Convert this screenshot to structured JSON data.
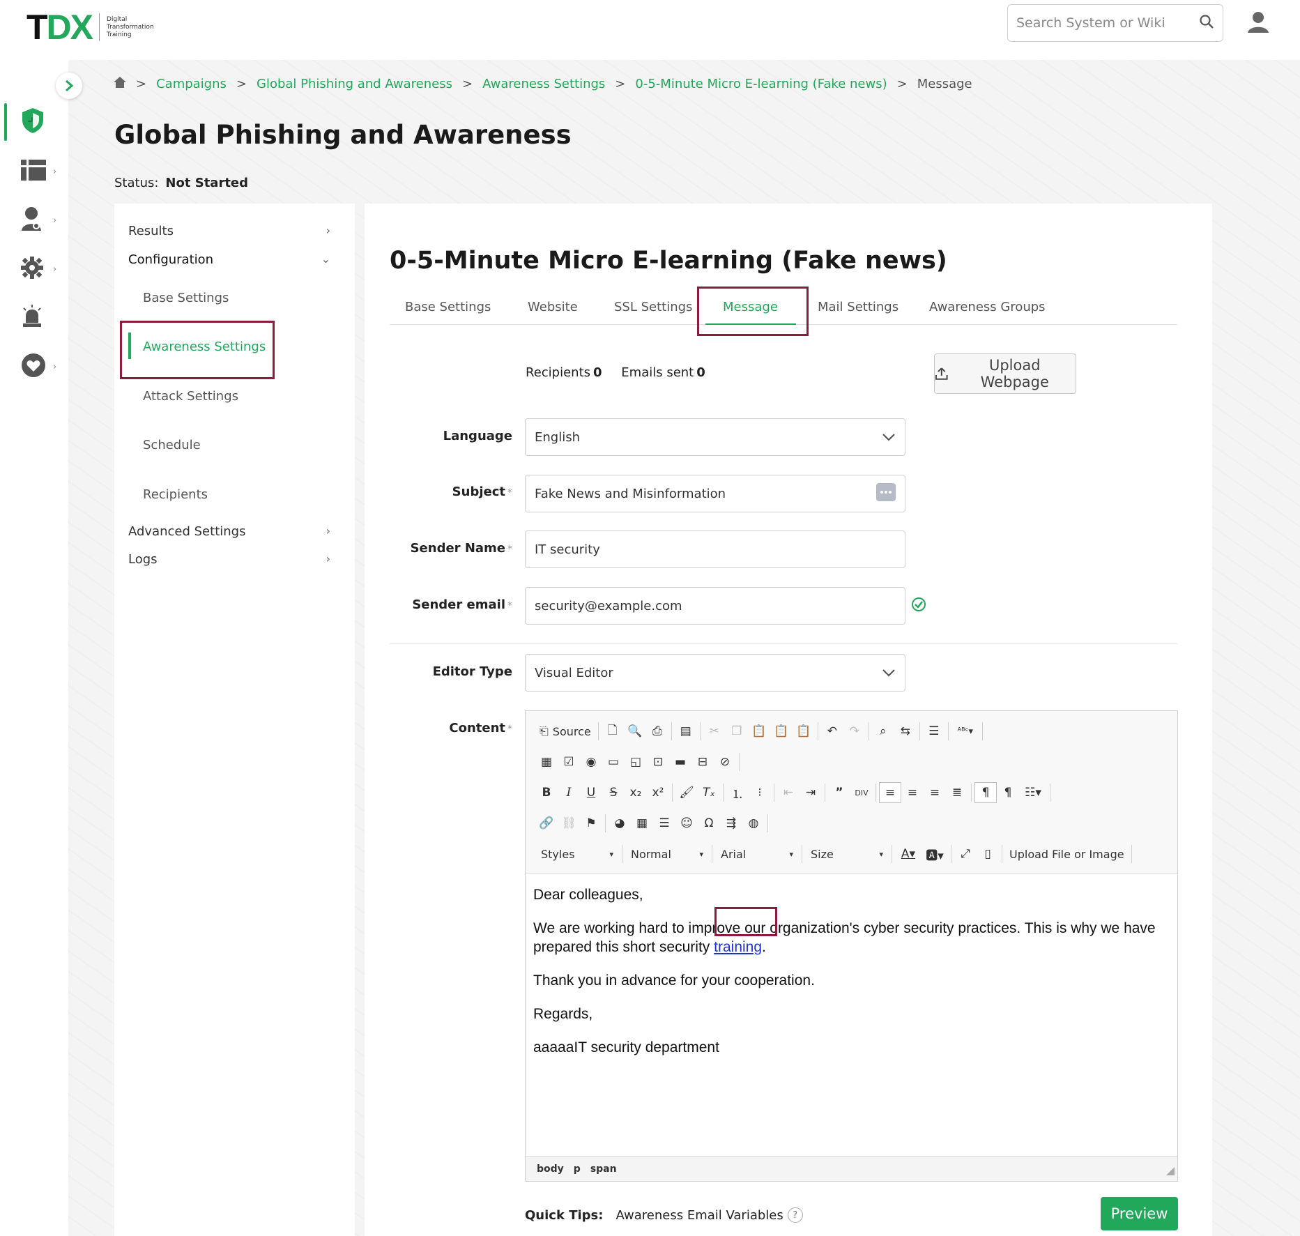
{
  "header": {
    "logo_main": "TDX",
    "logo_sub": [
      "Digital",
      "Transformation",
      "Training"
    ],
    "search_placeholder": "Search System or Wiki"
  },
  "breadcrumb": {
    "items": [
      "Campaigns",
      "Global Phishing and Awareness",
      "Awareness Settings",
      "0-5-Minute Micro E-learning (Fake news)"
    ],
    "current": "Message",
    "separator": ">"
  },
  "page": {
    "title": "Global Phishing and Awareness",
    "status_label": "Status:",
    "status_value": "Not Started"
  },
  "side_panel": {
    "results": "Results",
    "configuration": "Configuration",
    "sub_items": [
      "Base Settings",
      "Awareness Settings",
      "Attack Settings",
      "Schedule",
      "Recipients"
    ],
    "advanced": "Advanced Settings",
    "logs": "Logs"
  },
  "content": {
    "title": "0-5-Minute Micro E-learning (Fake news)",
    "tabs": [
      "Base Settings",
      "Website",
      "SSL Settings",
      "Message",
      "Mail Settings",
      "Awareness Groups"
    ],
    "recipients_label": "Recipients",
    "recipients_value": "0",
    "emails_sent_label": "Emails sent",
    "emails_sent_value": "0",
    "upload_label": "Upload Webpage"
  },
  "form": {
    "language_label": "Language",
    "language_value": "English",
    "subject_label": "Subject",
    "subject_value": "Fake News and Misinformation",
    "sender_name_label": "Sender Name",
    "sender_name_value": "IT security",
    "sender_email_label": "Sender email",
    "sender_email_value": "security@example.com",
    "editor_type_label": "Editor Type",
    "editor_type_value": "Visual Editor",
    "content_label": "Content",
    "required_mark": "*"
  },
  "editor": {
    "source_label": "Source",
    "styles_label": "Styles",
    "format_label": "Normal",
    "font_label": "Arial",
    "size_label": "Size",
    "upload_label": "Upload File or Image",
    "greeting": "Dear colleagues,",
    "paragraph_1": "We are working hard to improve our organization's cyber security practices. This is why we have prepared this short security",
    "link_text": "training",
    "paragraph_1_end": ".",
    "paragraph_2": "Thank you in advance for your cooperation.",
    "paragraph_3": "Regards,",
    "signature": "aaaaaIT security department",
    "path": [
      "body",
      "p",
      "span"
    ]
  },
  "footer": {
    "quick_tips_label": "Quick Tips:",
    "variables_link": "Awareness Email Variables",
    "help": "?",
    "preview_label": "Preview"
  },
  "colors": {
    "brand_green": "#22a85a",
    "highlight": "#8b1c3c"
  }
}
